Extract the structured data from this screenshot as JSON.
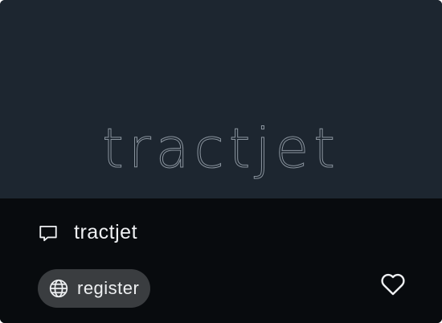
{
  "card": {
    "banner_text": "tractjet",
    "project_name": "tractjet",
    "register_label": "register"
  },
  "icons": {
    "comment": "comment-icon",
    "globe": "globe-icon",
    "favorite": "heart-icon"
  },
  "colors": {
    "banner_background": "#1d2630",
    "card_background": "#080b0e",
    "pill_background": "#3a3d40",
    "text": "#eef0f2"
  }
}
